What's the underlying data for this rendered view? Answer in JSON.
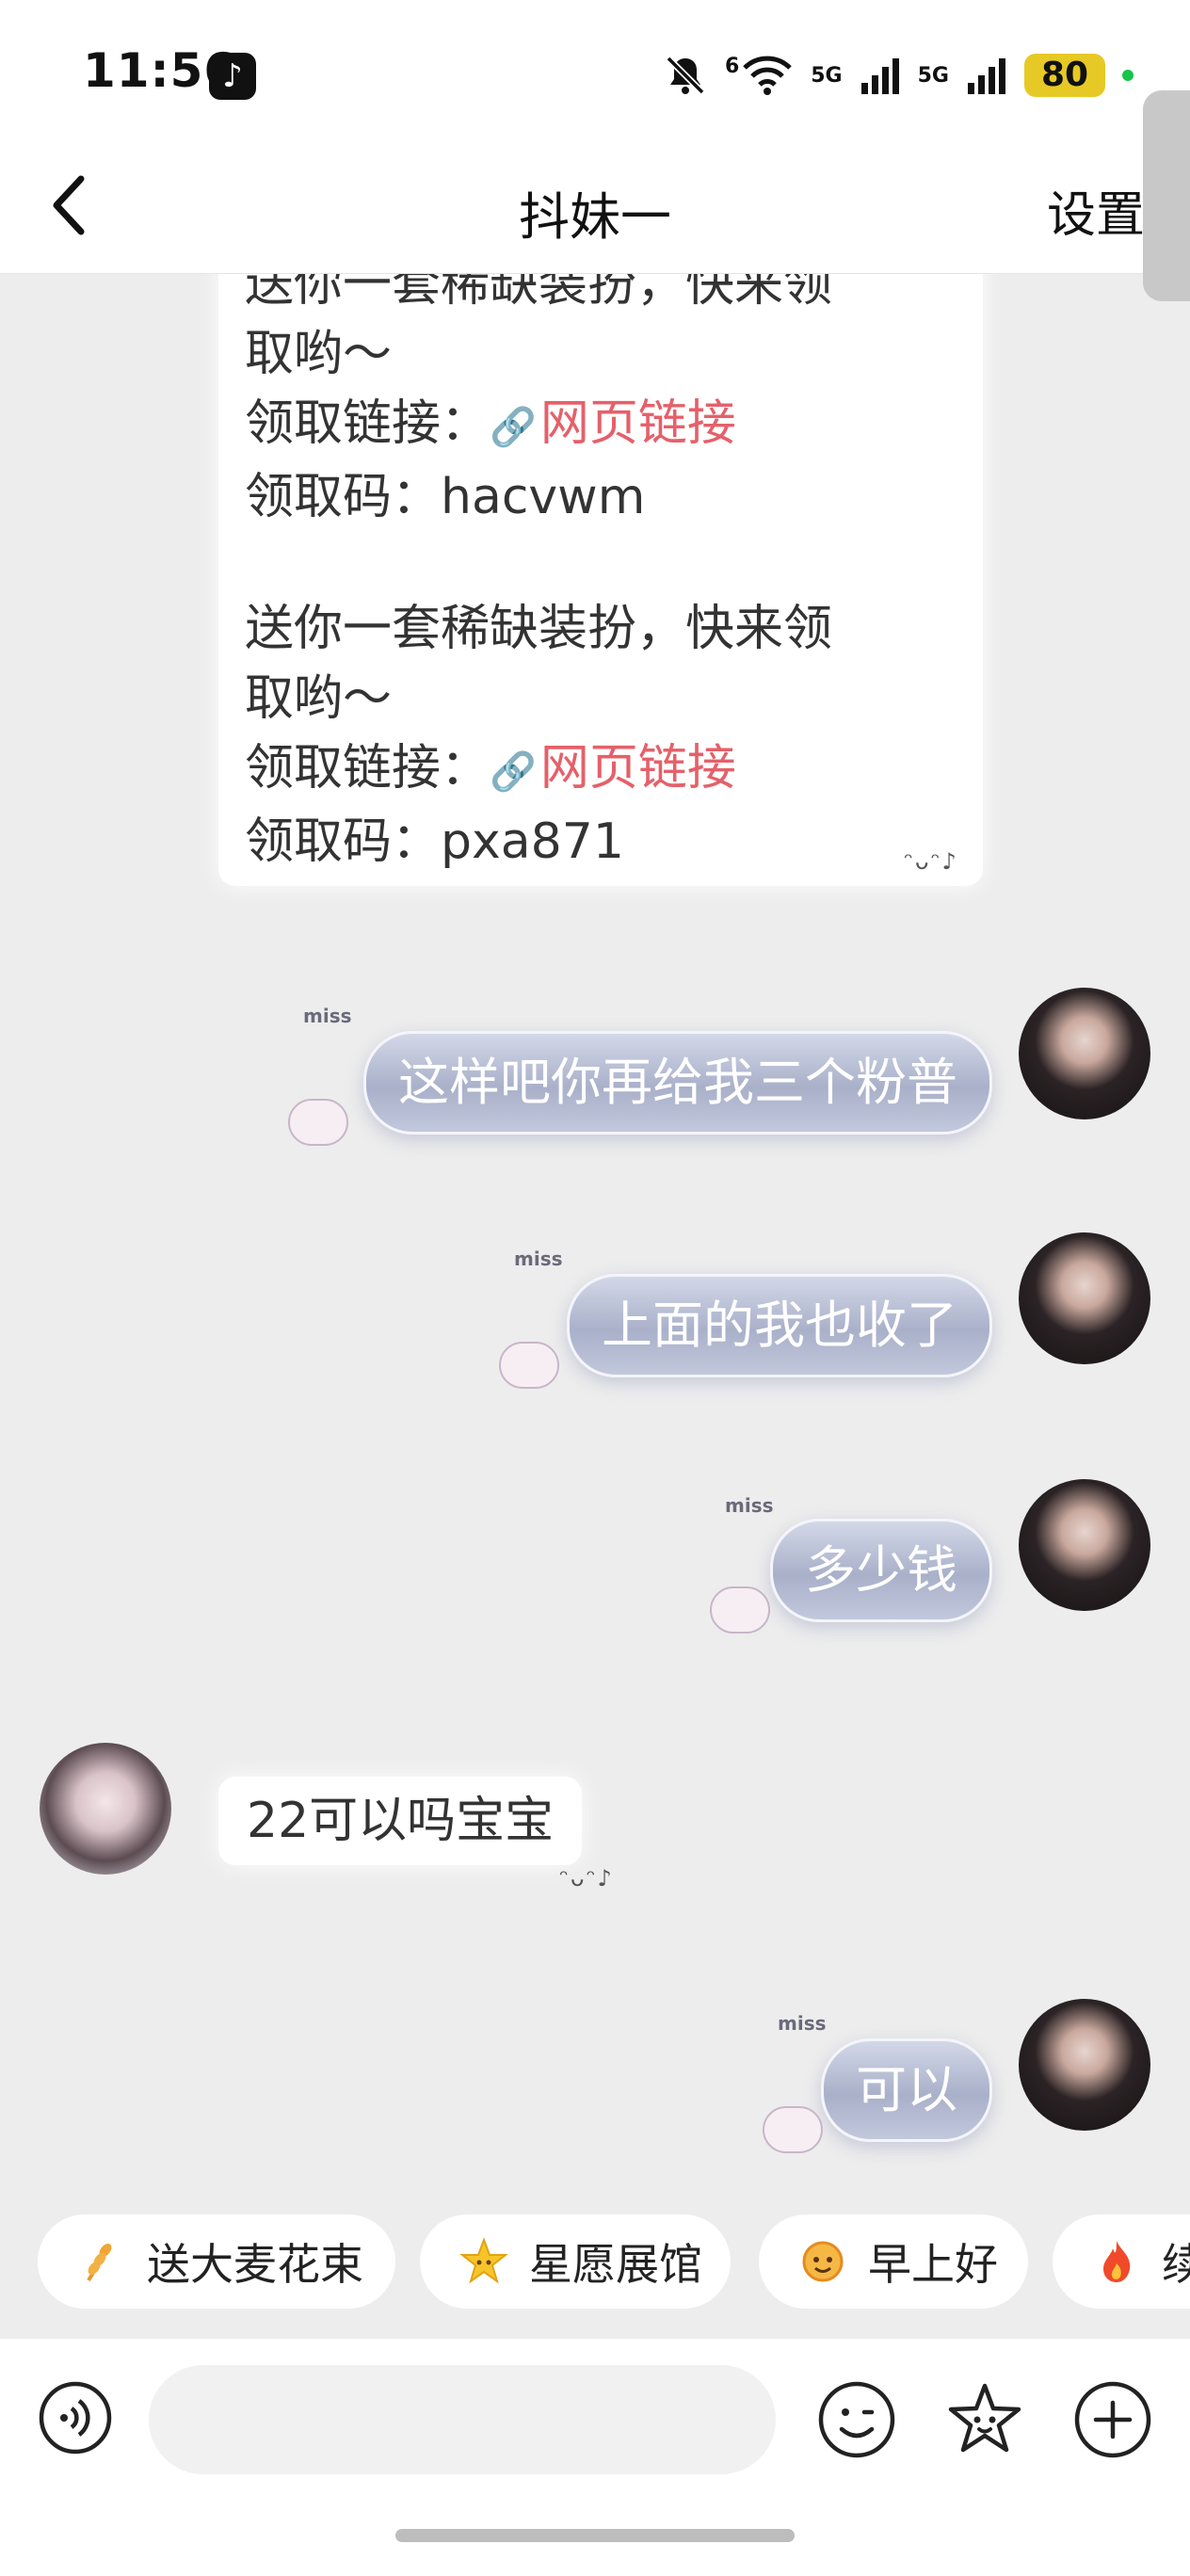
{
  "status_bar": {
    "time": "11:56",
    "battery": "80",
    "net_1": "5G",
    "net_2": "5G",
    "wifi_tag": "6"
  },
  "header": {
    "title": "抖妹一",
    "settings_label": "设置"
  },
  "messages": {
    "offer": {
      "clipped_top": "送你一套稀缺装扮，快来领",
      "p1_line2": "取哟～",
      "p1_link_label": "领取链接：",
      "p1_link_text": "网页链接",
      "p1_code": "领取码：hacvwm",
      "p2_line1": "送你一套稀缺装扮，快来领",
      "p2_line2": "取哟～",
      "p2_link_label": "领取链接：",
      "p2_link_text": "网页链接",
      "p2_code": "领取码：pxa871"
    },
    "right_1": "这样吧你再给我三个粉普",
    "right_2": "上面的我也收了",
    "right_3": "多少钱",
    "left_reply": "22可以吗宝宝",
    "right_4": "可以",
    "sticker_tag": "miss"
  },
  "quick_replies": [
    {
      "label": "送大麦花束",
      "icon": "wheat-icon"
    },
    {
      "label": "星愿展馆",
      "icon": "star-face-icon"
    },
    {
      "label": "早上好",
      "icon": "sun-face-icon"
    },
    {
      "label": "续",
      "icon": "fire-icon"
    }
  ],
  "colors": {
    "link": "#e5606a",
    "bubble_right": "#a9b0c9",
    "background": "#ededed"
  }
}
